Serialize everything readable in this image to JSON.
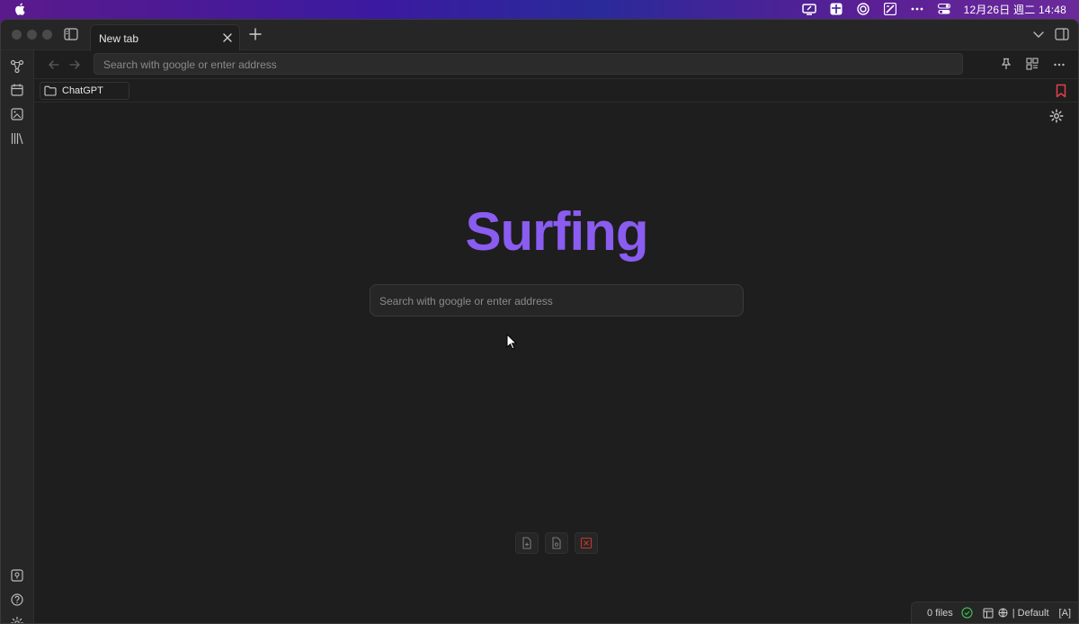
{
  "menubar": {
    "clock": "12月26日 週二  14:48",
    "icons": [
      "apple-icon",
      "display-icon",
      "table-icon",
      "openai-icon",
      "image-edit-icon",
      "more-icon",
      "control-center-icon"
    ]
  },
  "tab": {
    "label": "New tab"
  },
  "toolbar": {
    "address_placeholder": "Search with google or enter address"
  },
  "bookmarks": {
    "folder_label": "ChatGPT"
  },
  "main": {
    "brand": "Surfing",
    "search_placeholder": "Search with google or enter address"
  },
  "statusbar": {
    "files": "0 files",
    "mode": "| Default",
    "indicator": "[A]"
  },
  "colors": {
    "brand": "#8a5cf0",
    "bookmark": "#e0424a",
    "sync_ok": "#3fb950",
    "close_red": "#c0392b"
  }
}
